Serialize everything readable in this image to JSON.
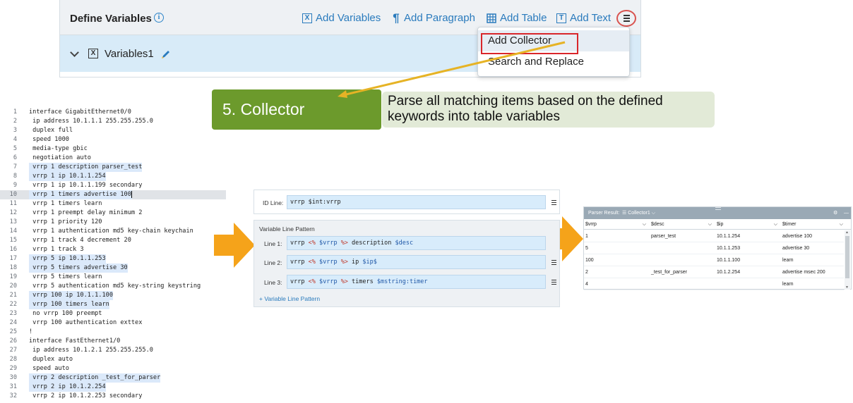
{
  "toolbar": {
    "title": "Define Variables",
    "info_icon": "i",
    "add_variables": "Add Variables",
    "add_paragraph": "Add Paragraph",
    "add_table": "Add Table",
    "add_text": "Add Text",
    "variable_name": "Variables1",
    "x_glyph": "X",
    "t_glyph": "T",
    "para_glyph": "¶"
  },
  "dropdown": {
    "items": [
      "Add Collector",
      "Search and Replace"
    ]
  },
  "callout": {
    "step": "5. Collector",
    "description": "Parse all matching items based on the defined keywords into table variables"
  },
  "code": {
    "lines": [
      {
        "n": "1",
        "t": "interface GigabitEthernet0/0"
      },
      {
        "n": "2",
        "t": " ip address 10.1.1.1 255.255.255.0"
      },
      {
        "n": "3",
        "t": " duplex full"
      },
      {
        "n": "4",
        "t": " speed 1000"
      },
      {
        "n": "5",
        "t": " media-type gbic"
      },
      {
        "n": "6",
        "t": " negotiation auto"
      },
      {
        "n": "7",
        "t": " vrrp 1 description parser_test"
      },
      {
        "n": "8",
        "t": " vrrp 1 ip 10.1.1.254"
      },
      {
        "n": "9",
        "t": " vrrp 1 ip 10.1.1.199 secondary"
      },
      {
        "n": "10",
        "t": " vrrp 1 timers advertise 100"
      },
      {
        "n": "11",
        "t": " vrrp 1 timers learn"
      },
      {
        "n": "12",
        "t": " vrrp 1 preempt delay minimum 2"
      },
      {
        "n": "13",
        "t": " vrrp 1 priority 120"
      },
      {
        "n": "14",
        "t": " vrrp 1 authentication md5 key-chain keychain"
      },
      {
        "n": "15",
        "t": " vrrp 1 track 4 decrement 20"
      },
      {
        "n": "16",
        "t": " vrrp 1 track 3"
      },
      {
        "n": "17",
        "t": " vrrp 5 ip 10.1.1.253"
      },
      {
        "n": "18",
        "t": " vrrp 5 timers advertise 30"
      },
      {
        "n": "19",
        "t": " vrrp 5 timers learn"
      },
      {
        "n": "20",
        "t": " vrrp 5 authentication md5 key-string keystring"
      },
      {
        "n": "21",
        "t": " vrrp 100 ip 10.1.1.100"
      },
      {
        "n": "22",
        "t": " vrrp 100 timers learn"
      },
      {
        "n": "23",
        "t": " no vrrp 100 preempt"
      },
      {
        "n": "24",
        "t": " vrrp 100 authentication exttex"
      },
      {
        "n": "25",
        "t": "!"
      },
      {
        "n": "26",
        "t": "interface FastEthernet1/0"
      },
      {
        "n": "27",
        "t": " ip address 10.1.2.1 255.255.255.0"
      },
      {
        "n": "28",
        "t": " duplex auto"
      },
      {
        "n": "29",
        "t": " speed auto"
      },
      {
        "n": "30",
        "t": " vrrp 2 description _test_for_parser"
      },
      {
        "n": "31",
        "t": " vrrp 2 ip 10.1.2.254"
      },
      {
        "n": "32",
        "t": " vrrp 2 ip 10.1.2.253 secondary"
      }
    ]
  },
  "pattern": {
    "id_label": "ID Line:",
    "id_value": "vrrp $int:vrrp",
    "vlp_title": "Variable Line Pattern",
    "line1_label": "Line 1:",
    "line2_label": "Line 2:",
    "line3_label": "Line 3:",
    "add_vlp": "+ Variable Line Pattern"
  },
  "result": {
    "title": "Parser Result:",
    "selected": "Collector1",
    "columns": [
      "$vrrp",
      "$desc",
      "$ip",
      "$timer"
    ],
    "rows": [
      [
        "1",
        "parser_test",
        "10.1.1.254",
        "advertise 100"
      ],
      [
        "5",
        "",
        "10.1.1.253",
        "advertise 30"
      ],
      [
        "100",
        "",
        "10.1.1.100",
        "learn"
      ],
      [
        "2",
        "_test_for_parser",
        "10.1.2.254",
        "advertise msec 200"
      ],
      [
        "4",
        "",
        "",
        "learn"
      ]
    ]
  }
}
